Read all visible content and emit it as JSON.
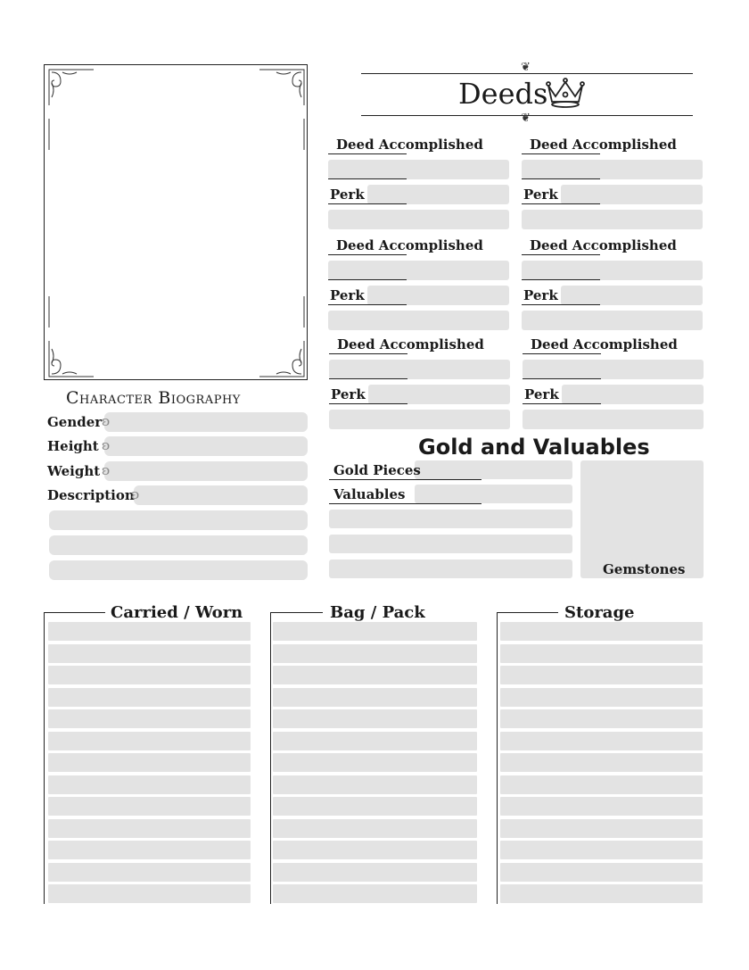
{
  "deeds": {
    "title": "Deeds",
    "blocks": [
      {
        "deed_label": "Deed Accomplished",
        "perk_label": "Perk"
      },
      {
        "deed_label": "Deed Accomplished",
        "perk_label": "Perk"
      },
      {
        "deed_label": "Deed Accomplished",
        "perk_label": "Perk"
      },
      {
        "deed_label": "Deed Accomplished",
        "perk_label": "Perk"
      },
      {
        "deed_label": "Deed Accomplished",
        "perk_label": "Perk"
      },
      {
        "deed_label": "Deed Accomplished",
        "perk_label": "Perk"
      }
    ]
  },
  "biography": {
    "title": "Character Biography",
    "fields": [
      "Gender",
      "Height",
      "Weight",
      "Description"
    ]
  },
  "gold": {
    "title": "Gold and Valuables",
    "gold_pieces_label": "Gold Pieces",
    "valuables_label": "Valuables",
    "gemstones_label": "Gemstones"
  },
  "inventory": {
    "columns": [
      "Carried / Worn",
      "Bag / Pack",
      "Storage"
    ]
  },
  "icons": {
    "crown": "crown-icon",
    "ornament": "fleuron-ornament-icon",
    "scroll": "scroll-flourish-icon"
  },
  "colors": {
    "field": "#e3e3e3",
    "ink": "#1a1a1a"
  }
}
